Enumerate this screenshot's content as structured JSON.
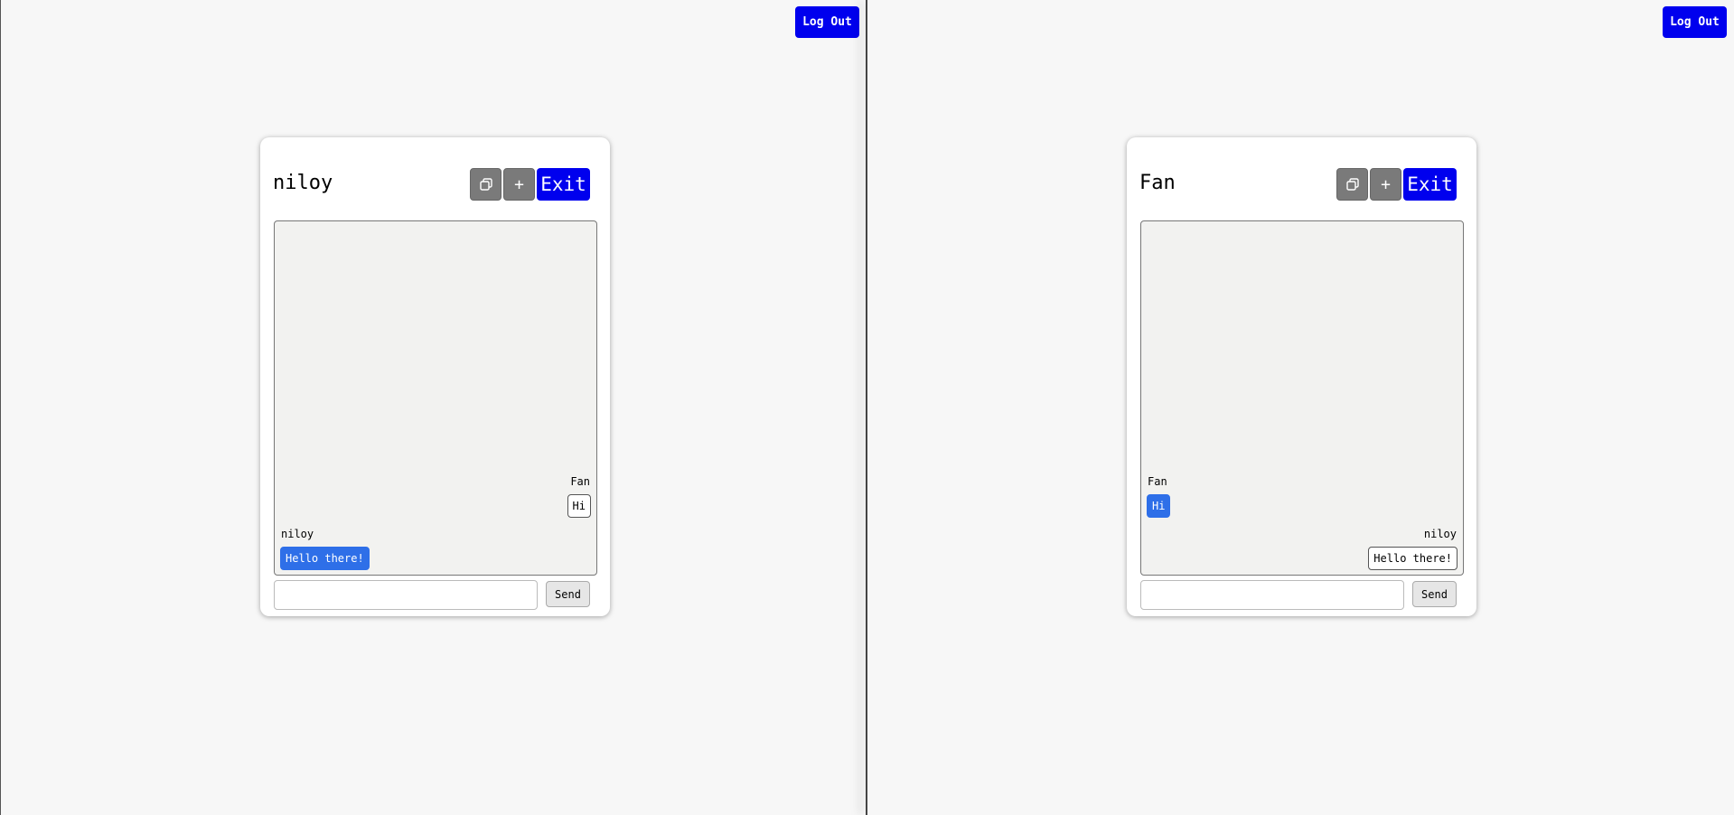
{
  "left": {
    "logout_label": "Log Out",
    "title": "niloy",
    "copy_icon": "copy-icon",
    "add_label": "+",
    "exit_label": "Exit",
    "messages": [
      {
        "sender": "Fan",
        "text": "Hi",
        "own": false
      },
      {
        "sender": "niloy",
        "text": "Hello there!",
        "own": true
      }
    ],
    "input_value": "",
    "send_label": "Send"
  },
  "right": {
    "logout_label": "Log Out",
    "title": "Fan",
    "copy_icon": "copy-icon",
    "add_label": "+",
    "exit_label": "Exit",
    "messages": [
      {
        "sender": "Fan",
        "text": "Hi",
        "own": true
      },
      {
        "sender": "niloy",
        "text": "Hello there!",
        "own": false
      }
    ],
    "input_value": "",
    "send_label": "Send"
  },
  "colors": {
    "accent": "#0000ee",
    "own_bubble": "#2e6fe8"
  }
}
